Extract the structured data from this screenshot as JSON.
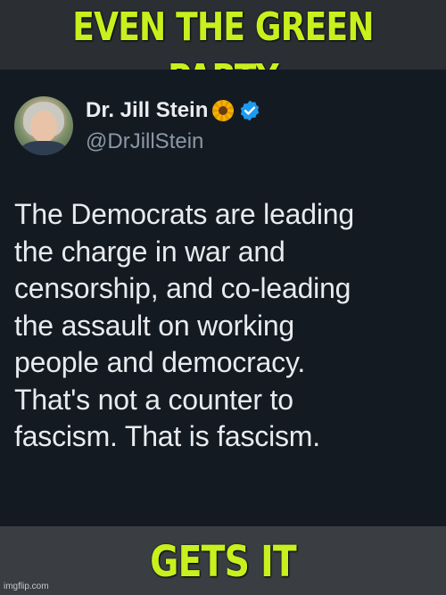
{
  "meme": {
    "top_text": "EVEN THE GREEN PARTY",
    "bottom_text": "GETS IT",
    "caption_color": "#c8f01e"
  },
  "tweet": {
    "display_name": "Dr. Jill Stein",
    "name_emoji": "sunflower-icon",
    "verified": "verified-badge-icon",
    "handle": "@DrJillStein",
    "lines": [
      "The Democrats are leading",
      "the charge in war and",
      "censorship, and co-leading",
      "the assault on working",
      "people and democracy.",
      "That's not a counter to",
      "fascism. That is fascism."
    ]
  },
  "watermark": "imgflip.com"
}
